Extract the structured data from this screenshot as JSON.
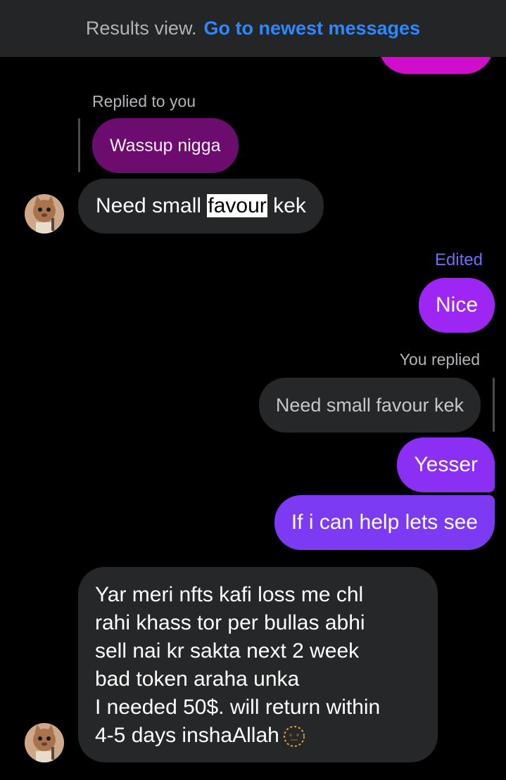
{
  "banner": {
    "label": "Results view.",
    "link": "Go to newest messages"
  },
  "conversation": {
    "reply_context_1": "Replied to you",
    "quoted_message_1": "Wassup nigga",
    "message_1": {
      "before": "Need small ",
      "highlight": "favour",
      "after": " kek"
    },
    "edited_label": "Edited",
    "message_2": "Nice",
    "reply_context_2": "You replied",
    "quoted_message_2": "Need small favour kek",
    "message_3": "Yesser",
    "message_4": "If i can help lets see",
    "message_5": {
      "lines": [
        "Yar meri nfts kafi loss me chl",
        "rahi khass tor per bullas abhi",
        "sell nai kr sakta next 2 week",
        "bad token araha unka",
        "I needed 50$. will return within",
        "4-5 days inshaAllah"
      ],
      "emoji": "dotted-line-face-emoji"
    }
  },
  "colors": {
    "banner_bg": "#242526",
    "link": "#2d88ff",
    "edited": "#6b6ff5",
    "incoming_bubble": "#262728",
    "outgoing_1": "#9e26f5",
    "outgoing_2": "#8a2ff3",
    "outgoing_3": "#7c3bf2",
    "quoted_purple": "#6b0c6e"
  },
  "icons": {
    "avatar": "cat-avatar-icon"
  }
}
